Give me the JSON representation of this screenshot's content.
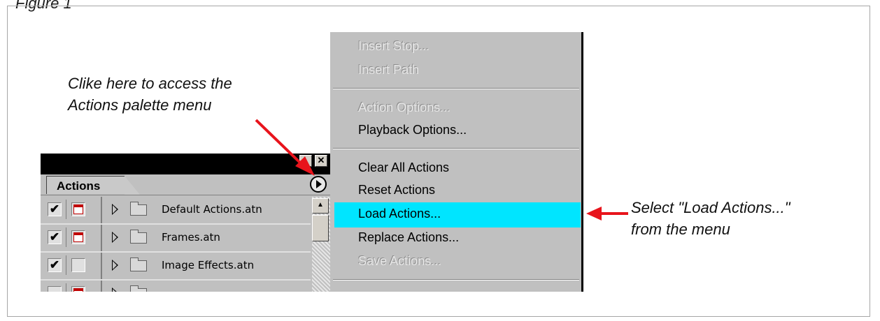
{
  "figure_label": "Figure 1",
  "note_top": {
    "line1": "Clike here to access the",
    "line2": "Actions palette menu"
  },
  "note_right": {
    "line1": "Select \"Load Actions...\"",
    "line2": "from the menu"
  },
  "palette": {
    "tab_label": "Actions",
    "rows": [
      {
        "label": "Default Actions.atn",
        "checked": "✔"
      },
      {
        "label": "Frames.atn",
        "checked": "✔"
      },
      {
        "label": "Image Effects.atn",
        "checked": "✔"
      }
    ],
    "scroll_up_glyph": "▲",
    "close_glyph": "✕"
  },
  "menu": {
    "items": [
      {
        "label": "Insert Stop...",
        "enabled": false
      },
      {
        "label": "Insert Path",
        "enabled": false
      },
      {
        "label": "Action Options...",
        "enabled": false
      },
      {
        "label": "Playback Options...",
        "enabled": true
      },
      {
        "label": "Clear All Actions",
        "enabled": true
      },
      {
        "label": "Reset Actions",
        "enabled": true
      },
      {
        "label": "Load Actions...",
        "enabled": true,
        "highlighted": true
      },
      {
        "label": "Replace Actions...",
        "enabled": true
      },
      {
        "label": "Save Actions...",
        "enabled": false
      }
    ],
    "highlight_color": "#00e5ff"
  },
  "colors": {
    "arrow": "#e8141c",
    "menu_bg": "#c0c0c0",
    "titlebar": "#000000"
  }
}
